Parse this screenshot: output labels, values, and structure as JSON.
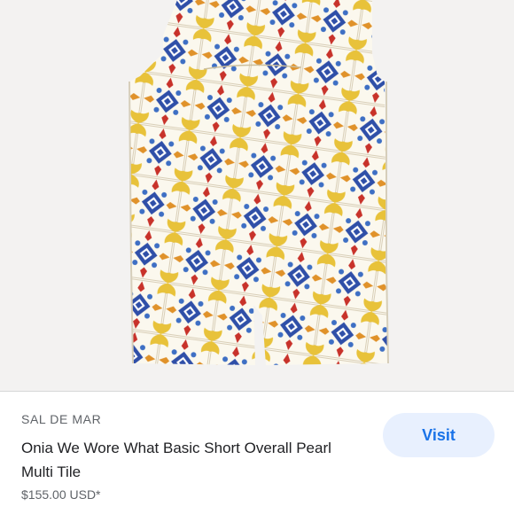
{
  "product": {
    "brand": "SAL DE MAR",
    "title": "Onia We Wore What Basic Short Overall Pearl Multi Tile",
    "price": "$155.00 USD*"
  },
  "actions": {
    "visit_label": "Visit"
  },
  "colors": {
    "accent": "#1a73e8",
    "button_bg": "#e8f0fe",
    "image_bg": "#f3f2f1",
    "tile_yellow": "#e8c23a",
    "tile_blue": "#2f4fa8",
    "tile_red": "#c8322a"
  }
}
